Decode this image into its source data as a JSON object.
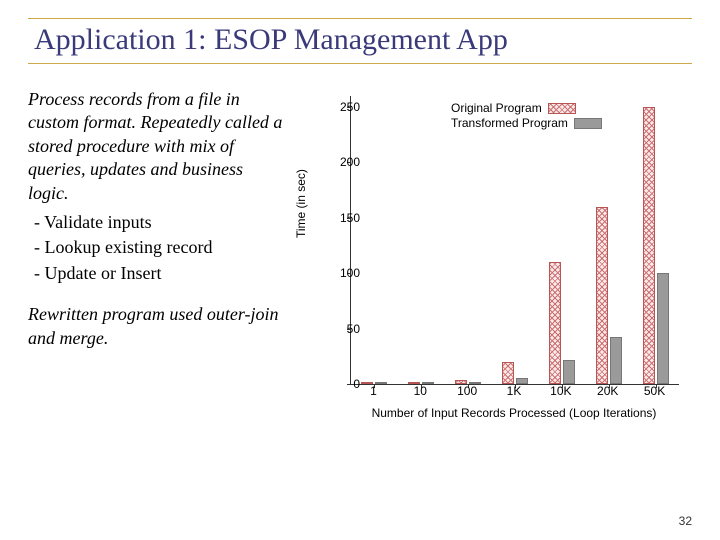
{
  "title": "Application 1: ESOP Management App",
  "left": {
    "para1": "Process records from a file in custom format. Repeatedly called a stored procedure with mix of queries, updates and business logic.",
    "b1": "- Validate inputs",
    "b2": "- Lookup existing record",
    "b3": "- Update or Insert",
    "para2": "Rewritten program used outer-join and merge."
  },
  "chart_data": {
    "type": "bar",
    "title": "",
    "xlabel": "Number of Input Records Processed (Loop Iterations)",
    "ylabel": "Time (in sec)",
    "ylim": [
      0,
      260
    ],
    "yticks": [
      0,
      50,
      100,
      150,
      200,
      250
    ],
    "categories": [
      "1",
      "10",
      "100",
      "1K",
      "10K",
      "20K",
      "50K"
    ],
    "series": [
      {
        "name": "Original Program",
        "values": [
          1,
          2,
          4,
          20,
          110,
          160,
          250
        ]
      },
      {
        "name": "Transformed Program",
        "values": [
          1,
          1,
          2,
          5,
          22,
          42,
          100
        ]
      }
    ]
  },
  "page_number": "32"
}
